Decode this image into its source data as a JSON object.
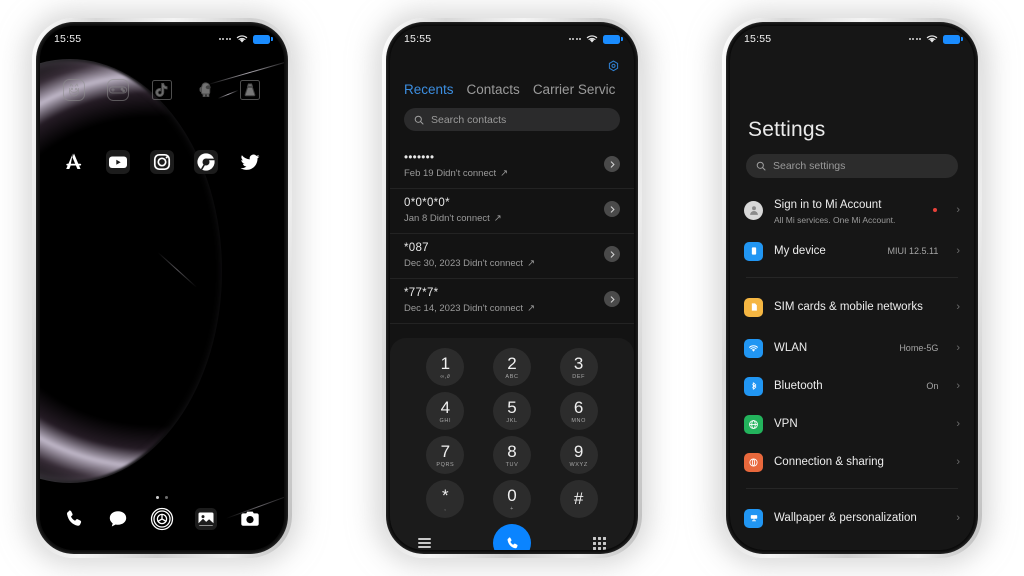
{
  "status_bar": {
    "time": "15:55"
  },
  "phone1": {
    "name": "home-screen",
    "row1_apps": [
      {
        "id": "app-cat",
        "label": "Cat app"
      },
      {
        "id": "app-gamepad",
        "label": "Games"
      },
      {
        "id": "app-tiktok",
        "label": "TikTok"
      },
      {
        "id": "app-amongus",
        "label": "Among Us"
      },
      {
        "id": "app-vlc",
        "label": "VLC"
      }
    ],
    "row2_apps": [
      {
        "id": "app-appstore",
        "label": "App Store"
      },
      {
        "id": "app-youtube",
        "label": "YouTube"
      },
      {
        "id": "app-instagram",
        "label": "Instagram"
      },
      {
        "id": "app-chrome",
        "label": "Chrome"
      },
      {
        "id": "app-twitter",
        "label": "Twitter"
      }
    ],
    "dock_apps": [
      {
        "id": "app-phone",
        "label": "Phone"
      },
      {
        "id": "app-messages",
        "label": "Messages"
      },
      {
        "id": "app-browser",
        "label": "Browser"
      },
      {
        "id": "app-gallery",
        "label": "Gallery"
      },
      {
        "id": "app-camera",
        "label": "Camera"
      }
    ],
    "page_dots": 2,
    "active_dot": 0
  },
  "phone2": {
    "name": "dialer-recents",
    "tabs": [
      {
        "label": "Recents",
        "active": true
      },
      {
        "label": "Contacts",
        "active": false
      },
      {
        "label": "Carrier Servic",
        "active": false
      }
    ],
    "search": {
      "placeholder": "Search contacts"
    },
    "calls": [
      {
        "number": "•••••••",
        "meta": "Feb 19 Didn't connect"
      },
      {
        "number": "0*0*0*0*",
        "meta": "Jan 8 Didn't connect"
      },
      {
        "number": "*087",
        "meta": "Dec 30, 2023 Didn't connect"
      },
      {
        "number": "*77*7*",
        "meta": "Dec 14, 2023 Didn't connect"
      }
    ],
    "keypad": [
      {
        "digit": "1",
        "letters": "∞,∂"
      },
      {
        "digit": "2",
        "letters": "ABC"
      },
      {
        "digit": "3",
        "letters": "DEF"
      },
      {
        "digit": "4",
        "letters": "GHI"
      },
      {
        "digit": "5",
        "letters": "JKL"
      },
      {
        "digit": "6",
        "letters": "MNO"
      },
      {
        "digit": "7",
        "letters": "PQRS"
      },
      {
        "digit": "8",
        "letters": "TUV"
      },
      {
        "digit": "9",
        "letters": "WXYZ"
      },
      {
        "digit": "*",
        "letters": ","
      },
      {
        "digit": "0",
        "letters": "+"
      },
      {
        "digit": "#",
        "letters": ""
      }
    ],
    "call_button_color": "#0a84ff",
    "accent_color": "#3c8ee0"
  },
  "phone3": {
    "name": "settings",
    "title": "Settings",
    "search": {
      "placeholder": "Search settings"
    },
    "groups": [
      {
        "items": [
          {
            "id": "mi-account",
            "label": "Sign in to Mi Account",
            "sub": "All Mi services. One Mi Account.",
            "value": "",
            "badge": true,
            "color": "#d8d8d8"
          },
          {
            "id": "my-device",
            "label": "My device",
            "sub": "",
            "value": "MIUI 12.5.11",
            "badge": false,
            "color": "#2196f3"
          }
        ]
      },
      {
        "items": [
          {
            "id": "sim-cards",
            "label": "SIM cards & mobile networks",
            "sub": "",
            "value": "",
            "badge": false,
            "color": "#f5b642"
          },
          {
            "id": "wlan",
            "label": "WLAN",
            "sub": "",
            "value": "Home-5G",
            "badge": false,
            "color": "#2196f3"
          },
          {
            "id": "bluetooth",
            "label": "Bluetooth",
            "sub": "",
            "value": "On",
            "badge": false,
            "color": "#2196f3"
          },
          {
            "id": "vpn",
            "label": "VPN",
            "sub": "",
            "value": "",
            "badge": false,
            "color": "#23b35c"
          },
          {
            "id": "connection-sharing",
            "label": "Connection & sharing",
            "sub": "",
            "value": "",
            "badge": false,
            "color": "#e8683c"
          }
        ]
      },
      {
        "items": [
          {
            "id": "wallpaper",
            "label": "Wallpaper & personalization",
            "sub": "",
            "value": "",
            "badge": false,
            "color": "#2196f3"
          }
        ]
      }
    ]
  }
}
